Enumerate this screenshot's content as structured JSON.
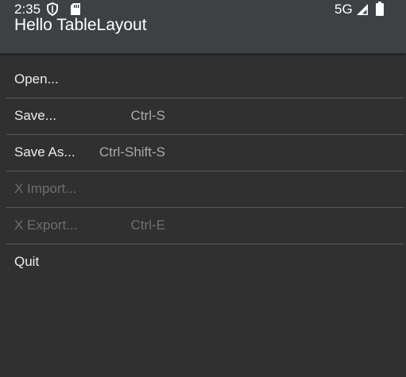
{
  "status_bar": {
    "time": "2:35",
    "network": "5G",
    "icons": [
      "shield-icon",
      "sd-card-icon",
      "signal-icon",
      "battery-icon"
    ]
  },
  "app_bar": {
    "title": "Hello TableLayout"
  },
  "menu": {
    "rows": [
      {
        "label": "Open...",
        "shortcut": "",
        "enabled": true
      },
      {
        "label": "Save...",
        "shortcut": "Ctrl-S",
        "enabled": true
      },
      {
        "label": "Save As...",
        "shortcut": "Ctrl-Shift-S",
        "enabled": true
      },
      {
        "label": "X Import...",
        "shortcut": "",
        "enabled": false
      },
      {
        "label": "X Export...",
        "shortcut": "Ctrl-E",
        "enabled": false
      },
      {
        "label": "Quit",
        "shortcut": "",
        "enabled": true
      }
    ]
  },
  "colors": {
    "background": "#303030",
    "app_bar": "#3e4144",
    "divider": "#5a5a5a",
    "text_enabled": "#ececec",
    "text_disabled": "#6e6e6e"
  }
}
